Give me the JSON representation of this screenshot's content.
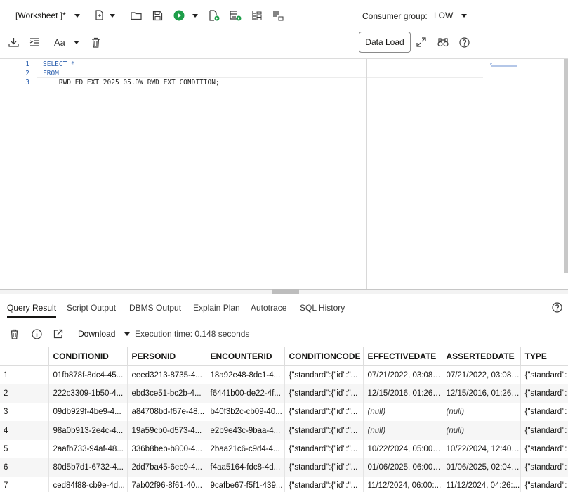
{
  "toolbar": {
    "worksheet_label": "[Worksheet ]*",
    "consumer_group_label": "Consumer group:",
    "consumer_group_value": "LOW",
    "data_load_label": "Data Load",
    "font_label": "Aa"
  },
  "editor": {
    "line_numbers": [
      "1",
      "2",
      "3"
    ],
    "line1": "SELECT *",
    "line2": "FROM",
    "line3": "    RWD_ED_EXT_2025_05.DW_RWD_EXT_CONDITION;"
  },
  "tabs": [
    "Query Result",
    "Script Output",
    "DBMS Output",
    "Explain Plan",
    "Autotrace",
    "SQL History"
  ],
  "results": {
    "download_label": "Download",
    "execution_time": "Execution time: 0.148 seconds"
  },
  "grid": {
    "columns": [
      "",
      "CONDITIONID",
      "PERSONID",
      "ENCOUNTERID",
      "CONDITIONCODE",
      "EFFECTIVEDATE",
      "ASSERTEDDATE",
      "TYPE"
    ],
    "rows": [
      [
        "1",
        "01fb878f-8dc4-45...",
        "eeed3213-8735-4...",
        "18a92e48-8dc1-4...",
        "{\"standard\":{\"id\":\"...",
        "07/21/2022, 03:08:...",
        "07/21/2022, 03:08:...",
        "{\"standard\":"
      ],
      [
        "2",
        "222c3309-1b50-4...",
        "ebd3ce51-bc2b-4...",
        "f6441b00-de22-4f...",
        "{\"standard\":{\"id\":\"...",
        "12/15/2016, 01:26:...",
        "12/15/2016, 01:26:...",
        "{\"standard\":"
      ],
      [
        "3",
        "09db929f-4be9-4...",
        "a84708bd-f67e-48...",
        "b40f3b2c-cb09-40...",
        "{\"standard\":{\"id\":\"...",
        "(null)",
        "(null)",
        "{\"standard\":"
      ],
      [
        "4",
        "98a0b913-2e4c-4...",
        "19a59cb0-d573-4...",
        "e2b9e43c-9baa-4...",
        "{\"standard\":{\"id\":\"...",
        "(null)",
        "(null)",
        "{\"standard\":"
      ],
      [
        "5",
        "2aafb733-94af-48...",
        "336b8beb-b800-4...",
        "2baa21c6-c9d4-4...",
        "{\"standard\":{\"id\":\"...",
        "10/22/2024, 05:00:...",
        "10/22/2024, 12:40:...",
        "{\"standard\":"
      ],
      [
        "6",
        "80d5b7d1-6732-4...",
        "2dd7ba45-6eb9-4...",
        "f4aa5164-fdc8-4d...",
        "{\"standard\":{\"id\":\"...",
        "01/06/2025, 06:00:...",
        "01/06/2025, 02:04:...",
        "{\"standard\":"
      ],
      [
        "7",
        "ced84f88-cb9e-4d...",
        "7ab02f96-8f61-40...",
        "9cafbe67-f5f1-439...",
        "{\"standard\":{\"id\":\"...",
        "11/12/2024, 06:00:...",
        "11/12/2024, 04:26:...",
        "{\"standard\":"
      ]
    ]
  },
  "colors": {
    "run_green": "#1e9e4a",
    "keyword_blue": "#2b5fae"
  }
}
